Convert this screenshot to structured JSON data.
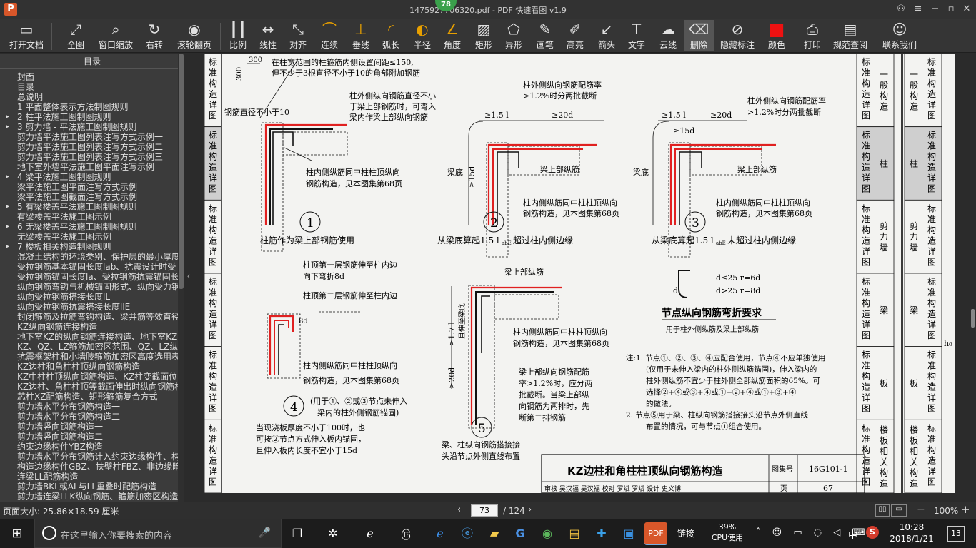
{
  "window": {
    "title": "1475927706320.pdf - PDF 快速看图 v1.9",
    "logo": "P",
    "badge": "78",
    "buttons": [
      "user-icon",
      "menu-icon",
      "minimize-icon",
      "maximize-icon",
      "close-icon"
    ]
  },
  "toolbar": [
    {
      "name": "open-file",
      "label": "打开文档",
      "icon": "▭"
    },
    {
      "name": "fit-all",
      "label": "全图",
      "icon": "⤢"
    },
    {
      "name": "window-zoom",
      "label": "窗口缩放",
      "icon": "⌕"
    },
    {
      "name": "rotate-right",
      "label": "右转",
      "icon": "↻"
    },
    {
      "name": "scroll-pan",
      "label": "滚轮翻页",
      "icon": "◉"
    },
    {
      "name": "scale",
      "label": "比例",
      "icon": "┃┃"
    },
    {
      "name": "linear",
      "label": "线性",
      "icon": "↔"
    },
    {
      "name": "align",
      "label": "对齐",
      "icon": "⤡"
    },
    {
      "name": "continuous",
      "label": "连续",
      "icon": "⌒"
    },
    {
      "name": "perpendicular",
      "label": "垂线",
      "icon": "⊥"
    },
    {
      "name": "arc-length",
      "label": "弧长",
      "icon": "◜"
    },
    {
      "name": "radius",
      "label": "半径",
      "icon": "◐"
    },
    {
      "name": "angle",
      "label": "角度",
      "icon": "∠"
    },
    {
      "name": "rectangle",
      "label": "矩形",
      "icon": "▨"
    },
    {
      "name": "irregular",
      "label": "异形",
      "icon": "⬠"
    },
    {
      "name": "pencil",
      "label": "画笔",
      "icon": "✎"
    },
    {
      "name": "highlighter",
      "label": "高亮",
      "icon": "✐"
    },
    {
      "name": "arrow",
      "label": "箭头",
      "icon": "↙"
    },
    {
      "name": "text",
      "label": "文字",
      "icon": "T"
    },
    {
      "name": "cloud-line",
      "label": "云线",
      "icon": "☁"
    },
    {
      "name": "delete",
      "label": "删除",
      "icon": "⌫"
    },
    {
      "name": "hide-marks",
      "label": "隐藏标注",
      "icon": "⊘"
    },
    {
      "name": "color",
      "label": "颜色",
      "icon": "■"
    },
    {
      "name": "print",
      "label": "打印",
      "icon": "⎙"
    },
    {
      "name": "standard-query",
      "label": "规范查阅",
      "icon": "▤"
    },
    {
      "name": "contact-us",
      "label": "联系我们",
      "icon": "☺"
    }
  ],
  "sidebar": {
    "title": "目录",
    "items": [
      {
        "label": "封面",
        "arrow": false
      },
      {
        "label": "目录",
        "arrow": false
      },
      {
        "label": "总说明",
        "arrow": false
      },
      {
        "label": "1 平面整体表示方法制图规则",
        "arrow": false
      },
      {
        "label": "2 柱平法施工图制图规则",
        "arrow": true
      },
      {
        "label": "3 剪力墙 - 平法施工图制图规则",
        "arrow": true
      },
      {
        "label": "剪力墙平法施工图列表注写方式示例一",
        "arrow": false
      },
      {
        "label": "剪力墙平法施工图列表注写方式示例二",
        "arrow": false
      },
      {
        "label": "剪力墙平法施工图列表注写方式示例三",
        "arrow": false
      },
      {
        "label": "地下室外墙平法施工图平面注写示例",
        "arrow": false
      },
      {
        "label": "4 梁平法施工图制图规则",
        "arrow": true
      },
      {
        "label": "梁平法施工图平面注写方式示例",
        "arrow": false
      },
      {
        "label": "梁平法施工图截面注写方式示例",
        "arrow": false
      },
      {
        "label": "5 有梁楼盖平法施工图制图规则",
        "arrow": true
      },
      {
        "label": "有梁楼盖平法施工图示例",
        "arrow": false
      },
      {
        "label": "6 无梁楼盖平法施工图制图规则",
        "arrow": true
      },
      {
        "label": "无梁楼盖平法施工图示例",
        "arrow": false
      },
      {
        "label": "7 楼板相关构造制图规则",
        "arrow": true
      },
      {
        "label": "混凝土结构的环境类别、保护层的最小厚度",
        "arrow": false
      },
      {
        "label": "受拉钢筋基本锚固长度lab、抗震设计时受",
        "arrow": false
      },
      {
        "label": "受拉钢筋锚固长度la、受拉钢筋抗震锚固长",
        "arrow": false
      },
      {
        "label": "纵向钢筋弯钩与机械锚固形式、纵向受力钢",
        "arrow": false
      },
      {
        "label": "纵向受拉钢筋搭接长度lL",
        "arrow": false
      },
      {
        "label": "纵向受拉钢筋抗震搭接长度llE",
        "arrow": false
      },
      {
        "label": "封闭箍筋及拉筋弯钩构造、梁并筋等效直径",
        "arrow": false
      },
      {
        "label": "KZ纵向钢筋连接构造",
        "arrow": false
      },
      {
        "label": "地下室KZ的纵向钢筋连接构造、地下室KZ的",
        "arrow": false
      },
      {
        "label": "KZ、QZ、LZ箍筋加密区范围、QZ、LZ纵向钢",
        "arrow": false
      },
      {
        "label": "抗震框架柱和小墙肢箍筋加密区高度选用表",
        "arrow": false
      },
      {
        "label": "KZ边柱和角柱柱顶纵向钢筋构造",
        "arrow": false
      },
      {
        "label": "KZ中柱柱顶纵向钢筋构造、KZ柱变截面位置",
        "arrow": false
      },
      {
        "label": "KZ边柱、角柱柱顶等截面伸出时纵向钢筋构",
        "arrow": false
      },
      {
        "label": "芯柱XZ配筋构造、矩形箍筋复合方式",
        "arrow": false
      },
      {
        "label": "剪力墙水平分布钢筋构造一",
        "arrow": false
      },
      {
        "label": "剪力墙水平分布钢筋构造二",
        "arrow": false
      },
      {
        "label": "剪力墙竖向钢筋构造一",
        "arrow": false
      },
      {
        "label": "剪力墙竖向钢筋构造二",
        "arrow": false
      },
      {
        "label": "约束边缘构件YBZ构造",
        "arrow": false
      },
      {
        "label": "剪力墙水平分布钢筋计入约束边缘构件、构",
        "arrow": false
      },
      {
        "label": "构造边缘构件GBZ、扶壁柱FBZ、非边缘暗柱",
        "arrow": false
      },
      {
        "label": "连梁LL配筋构造",
        "arrow": false
      },
      {
        "label": "剪力墙BKL或AL与LL重叠时配筋构造",
        "arrow": false
      },
      {
        "label": "剪力墙连梁LLK纵向钢筋、箍筋加密区构造",
        "arrow": false
      }
    ]
  },
  "document": {
    "left_tabs": [
      "标准构造详图",
      "标准构造详图",
      "标准构造详图",
      "标准构造详图",
      "标准构造详图",
      "标准构造详图"
    ],
    "right_tabs": [
      {
        "group": "标准构造详图",
        "label": "一般构造"
      },
      {
        "group": "标准构造详图",
        "label": "柱"
      },
      {
        "group": "标准构造详图",
        "label": "剪力墙"
      },
      {
        "group": "标准构造详图",
        "label": "梁"
      },
      {
        "group": "标准构造详图",
        "label": "板"
      },
      {
        "group": "标准构造详图",
        "label": "楼板相关构造"
      }
    ],
    "right_tabs2": [
      {
        "group": "标准构造详图",
        "label": "一般构造"
      },
      {
        "group": "标准构造详图",
        "label": "柱"
      },
      {
        "group": "标准构造详图",
        "label": "剪力墙"
      },
      {
        "group": "标准构造详图",
        "label": "梁"
      },
      {
        "group": "标准构造详图",
        "label": "板"
      },
      {
        "group": "标准构造详图",
        "label": "楼板相关构造"
      }
    ],
    "h0_label": "h₀",
    "note1": "在柱宽范围的柱箍筋内侧设置间距≤150,",
    "note1b": "但不少于3根直径不小于10的角部附加钢筋",
    "dim300a": "300",
    "dim300b": "300",
    "ann_outer1": "柱外侧纵向钢筋直径不小",
    "ann_outer2": "于梁上部钢筋时，可弯入",
    "ann_outer3": "梁内作梁上部纵向钢筋",
    "ann_dia": "钢筋直径不小于10",
    "ann_inner1": "柱内侧纵筋同中柱柱顶纵向",
    "ann_inner2": "钢筋构造，见本图集第68页",
    "ann_ratio1": "柱外侧纵向钢筋配筋率",
    "ann_ratio2": ">1.2%时分两批截断",
    "d2_top1": "≥1.5 l",
    "d2_top2": "≥20d",
    "beam_top": "梁上部纵筋",
    "beam_bottom": "梁底",
    "d15": "≥15d",
    "cap1": "柱筋作为梁上部钢筋使用",
    "cap2": "从梁底算起1.5 l",
    "cap2b": "超过柱内侧边缘",
    "cap3": "从梁底算起1.5 l",
    "cap3b": "未超过柱内侧边缘",
    "sub_abe": "abE",
    "n1": "1",
    "n2": "2",
    "n3": "3",
    "n4": "4",
    "n5": "5",
    "d4_a1": "柱顶第一层钢筋伸至柱内边",
    "d4_a2": "向下弯折8d",
    "d4_b1": "柱顶第二层钢筋伸至柱内边",
    "d4_8d": "8d",
    "d4_note1": "(用于①、②或③节点未伸入",
    "d4_note2": "梁内的柱外侧钢筋锚固)",
    "d4_slab1": "当现浇板厚度不小于100时，也",
    "d4_slab2": "可按②节点方式伸入板内锚固，",
    "d4_slab3": "且伸入板内长度不宜小于15d",
    "d5_v1": "≥1.7 l",
    "d5_v2": "且伸至梁底",
    "d5_20d": "≥20d",
    "d5_r1": "梁上部纵向钢筋配筋",
    "d5_r2": "率>1.2%时，应分两",
    "d5_r3": "批截断。当梁上部纵",
    "d5_r4": "向钢筋为两排时，先",
    "d5_r5": "断第二排钢筋",
    "d5_cap1": "梁、柱纵向钢筋搭接接",
    "d5_cap2": "头沿节点外侧直线布置",
    "bend_d1": "d≤25  r=6d",
    "bend_d2": "d>25  r=8d",
    "bend_d": "d",
    "bend_title": "节点纵向钢筋弯折要求",
    "bend_sub": "用于柱外侧纵筋及梁上部纵筋",
    "notes": [
      "注:1. 节点①、②、③、④应配合使用，节点④不应单独使用",
      "(仅用于未伸入梁内的柱外侧纵筋锚固)，伸入梁内的",
      "柱外侧纵筋不宜少于柱外侧全部纵筋面积的65%。可",
      "选择②+④或③+④或①+②+④或①+③+④",
      "的做法。",
      "2. 节点⑤用于梁、柱纵向钢筋搭接接头沿节点外侧直线",
      "布置的情况，可与节点①组合使用。"
    ],
    "title_block": {
      "title": "KZ边柱和角柱柱顶纵向钢筋构造",
      "atlas_label": "图集号",
      "atlas_no": "16G101-1",
      "row2": "审核 吴汉福 吴汉福 校对 罗斌 罗斌 设计 史义博",
      "page_label": "页",
      "page_no": "67"
    }
  },
  "status": {
    "page_size": "页面大小: 25.86×18.59 厘米",
    "current_page": "73",
    "total_pages": "/ 124",
    "zoom": "100%"
  },
  "taskbar": {
    "search_placeholder": "在这里输入你要搜索的内容",
    "apps": [
      "task-view-icon",
      "pinwheel-icon",
      "edge-e-icon",
      "spiral-icon",
      "edge-icon",
      "ie-icon",
      "folder-icon",
      "g-icon",
      "circle-icon",
      "notes-icon",
      "plus-icon",
      "briefcase-icon",
      "pdf-viewer-icon"
    ],
    "link_label": "链接",
    "cpu_percent": "39%",
    "cpu_label": "CPU使用",
    "ime": "中",
    "sogou": "S",
    "time": "10:28",
    "date": "2018/1/21",
    "notifications": "13"
  }
}
